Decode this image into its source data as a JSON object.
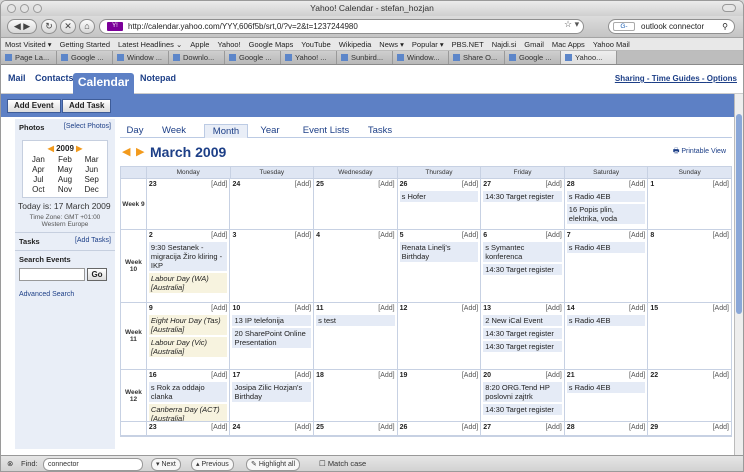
{
  "window": {
    "title": "Yahoo! Calendar - stefan_hozjan"
  },
  "toolbar": {
    "url": "http://calendar.yahoo.com/YYY,606f5b/srt,0/?v=2&t=1237244980",
    "favicon_text": "Y!",
    "search_engine": "G-",
    "search_value": "outlook connector"
  },
  "bookmarks": [
    "Most Visited ▾",
    "Getting Started",
    "Latest Headlines ⌄",
    "Apple",
    "Yahoo!",
    "Google Maps",
    "YouTube",
    "Wikipedia",
    "News ▾",
    "Popular ▾",
    "PBS.NET",
    "Najdi.si",
    "Gmail",
    "Mac Apps",
    "Yahoo Mail"
  ],
  "tabs": [
    "Page La...",
    "Google ...",
    "Window ...",
    "Downlo...",
    "Google ...",
    "Yahoo! ...",
    "Sunbird...",
    "Window...",
    "Share O...",
    "Google ...",
    "Yahoo..."
  ],
  "ymenu": {
    "mail": "Mail",
    "contacts": "Contacts",
    "calendar": "Calendar",
    "notepad": "Notepad",
    "sharing": "Sharing",
    "time_guides": "Time Guides",
    "options": "Options"
  },
  "actions": {
    "add_event": "Add Event",
    "add_task": "Add Task"
  },
  "sidebar": {
    "photos": "Photos",
    "select_photos": "[Select Photos]",
    "year": "2009",
    "months": [
      "Jan",
      "Feb",
      "Mar",
      "Apr",
      "May",
      "Jun",
      "Jul",
      "Aug",
      "Sep",
      "Oct",
      "Nov",
      "Dec"
    ],
    "today": "Today is: 17 March 2009",
    "timezone": "Time Zone: GMT +01:00 Western Europe",
    "tasks": "Tasks",
    "add_tasks": "[Add Tasks]",
    "search_events": "Search Events",
    "go": "Go",
    "advanced": "Advanced Search"
  },
  "view_tabs": [
    "Day",
    "Week",
    "Month",
    "Year",
    "Event Lists",
    "Tasks"
  ],
  "month_title": "March 2009",
  "printable": "Printable View",
  "day_headers": [
    "Monday",
    "Tuesday",
    "Wednesday",
    "Thursday",
    "Friday",
    "Saturday",
    "Sunday"
  ],
  "add_label": "[Add]",
  "weeks": [
    {
      "label": "Week 9",
      "days": [
        {
          "n": "23",
          "events": []
        },
        {
          "n": "24",
          "events": []
        },
        {
          "n": "25",
          "events": []
        },
        {
          "n": "26",
          "events": [
            {
              "t": "s Hofer"
            }
          ]
        },
        {
          "n": "27",
          "events": [
            {
              "t": "14:30 Target register"
            }
          ]
        },
        {
          "n": "28",
          "events": [
            {
              "t": "s Radio 4EB"
            },
            {
              "t": "16 Popis plin, elektrika, voda"
            }
          ]
        },
        {
          "n": "1",
          "events": []
        }
      ]
    },
    {
      "label": "Week 10",
      "days": [
        {
          "n": "2",
          "events": [
            {
              "t": "9:30 Sestanek - migracija Žiro kliring - IKP"
            },
            {
              "t": "Labour Day (WA) [Australia]",
              "hol": true
            }
          ]
        },
        {
          "n": "3",
          "events": []
        },
        {
          "n": "4",
          "events": []
        },
        {
          "n": "5",
          "events": [
            {
              "t": "Renata Linelj's Birthday"
            }
          ]
        },
        {
          "n": "6",
          "events": [
            {
              "t": "s Symantec konferenca"
            },
            {
              "t": "14:30 Target register"
            }
          ]
        },
        {
          "n": "7",
          "events": [
            {
              "t": "s Radio 4EB"
            }
          ]
        },
        {
          "n": "8",
          "events": []
        }
      ]
    },
    {
      "label": "Week 11",
      "days": [
        {
          "n": "9",
          "events": [
            {
              "t": "Eight Hour Day (Tas) [Australia]",
              "hol": true
            },
            {
              "t": "Labour Day (Vic) [Australia]",
              "hol": true
            }
          ]
        },
        {
          "n": "10",
          "events": [
            {
              "t": "13 IP telefonija"
            },
            {
              "t": "20 SharePoint Online Presentation"
            }
          ]
        },
        {
          "n": "11",
          "events": [
            {
              "t": "s test"
            }
          ]
        },
        {
          "n": "12",
          "events": []
        },
        {
          "n": "13",
          "events": [
            {
              "t": "2 New iCal Event"
            },
            {
              "t": "14:30 Target register"
            },
            {
              "t": "14:30 Target register"
            }
          ]
        },
        {
          "n": "14",
          "events": [
            {
              "t": "s Radio 4EB"
            }
          ]
        },
        {
          "n": "15",
          "events": []
        }
      ]
    },
    {
      "label": "Week 12",
      "days": [
        {
          "n": "16",
          "events": [
            {
              "t": "s Rok za oddajo clanka"
            },
            {
              "t": "Canberra Day (ACT) [Australia]",
              "hol": true
            }
          ]
        },
        {
          "n": "17",
          "events": [
            {
              "t": "Josipa Zilic Hozjan's Birthday"
            }
          ]
        },
        {
          "n": "18",
          "events": []
        },
        {
          "n": "19",
          "events": []
        },
        {
          "n": "20",
          "events": [
            {
              "t": "8:20 ORG.Tend HP poslovni zajtrk"
            },
            {
              "t": "14:30 Target register"
            }
          ]
        },
        {
          "n": "21",
          "events": [
            {
              "t": "s Radio 4EB"
            }
          ]
        },
        {
          "n": "22",
          "events": []
        }
      ]
    },
    {
      "label": "",
      "days": [
        {
          "n": "23",
          "events": []
        },
        {
          "n": "24",
          "events": []
        },
        {
          "n": "25",
          "events": []
        },
        {
          "n": "26",
          "events": []
        },
        {
          "n": "27",
          "events": []
        },
        {
          "n": "28",
          "events": []
        },
        {
          "n": "29",
          "events": []
        }
      ]
    }
  ],
  "findbar": {
    "find": "Find:",
    "query": "connector",
    "next": "Next",
    "previous": "Previous",
    "highlight": "Highlight all",
    "matchcase": "Match case"
  }
}
